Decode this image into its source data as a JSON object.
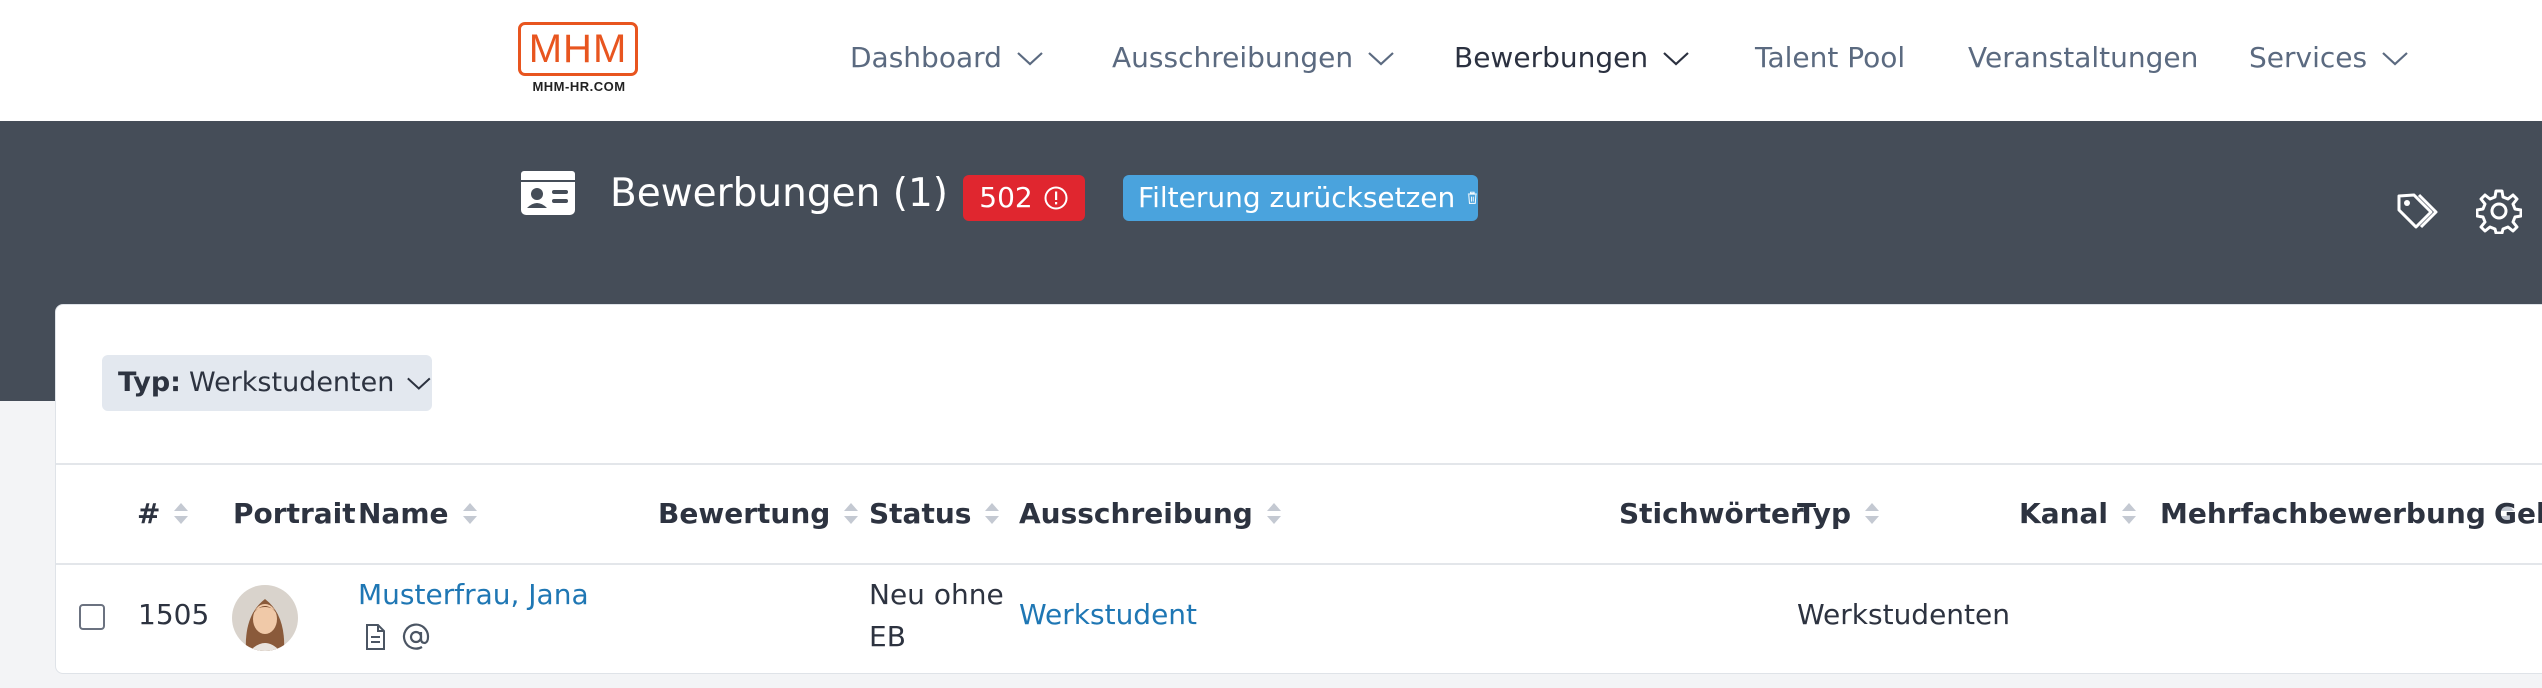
{
  "nav": {
    "logo_text": "MHM",
    "logo_subtext": "MHM-HR.COM",
    "items": [
      {
        "label": "Dashboard",
        "has_dropdown": true
      },
      {
        "label": "Ausschreibungen",
        "has_dropdown": true
      },
      {
        "label": "Bewerbungen",
        "has_dropdown": true,
        "active": true
      },
      {
        "label": "Talent Pool",
        "has_dropdown": false
      },
      {
        "label": "Veranstaltungen",
        "has_dropdown": false
      },
      {
        "label": "Services",
        "has_dropdown": true
      }
    ]
  },
  "header": {
    "title": "Bewerbungen (1)",
    "count_badge": "502",
    "reset_button": "Filterung zurücksetzen",
    "icons": [
      "id-card-icon",
      "tags-icon",
      "gear-icon",
      "alert-circle-icon",
      "trash-icon"
    ]
  },
  "filter": {
    "key": "Typ:",
    "value": "Werkstudenten"
  },
  "table": {
    "columns": [
      "#",
      "Portrait",
      "Name",
      "Bewertung",
      "Status",
      "Ausschreibung",
      "Stichwörter",
      "Typ",
      "Kanal",
      "Mehrfachbewerbung",
      "Geh"
    ],
    "rows": [
      {
        "id": "1505",
        "name": "Musterfrau, Jana",
        "status_line1": "Neu ohne",
        "status_line2": "EB",
        "ausschreibung": "Werkstudent",
        "typ": "Werkstudenten"
      }
    ]
  },
  "colors": {
    "brand_orange": "#e8551f",
    "header_bg": "#454d58",
    "badge_red": "#e0262f",
    "button_blue": "#4aa3dd",
    "link_blue": "#1f77b4"
  }
}
